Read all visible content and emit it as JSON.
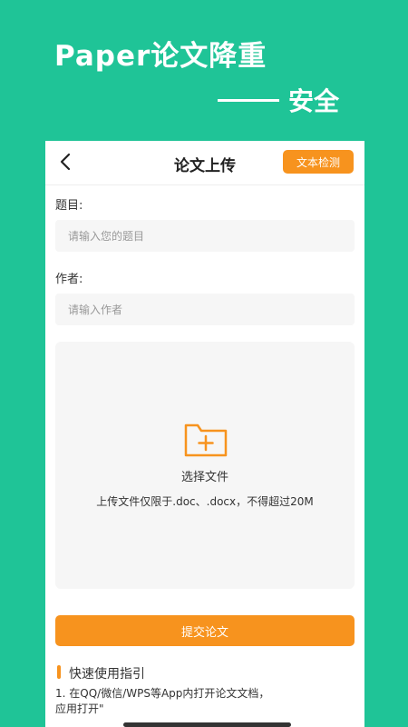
{
  "promo": {
    "title": "Paper论文降重",
    "subtitle": "安全"
  },
  "nav": {
    "back_icon": "chevron-left-icon",
    "title": "论文上传",
    "detect_button": "文本检测"
  },
  "form": {
    "title_label": "题目:",
    "title_placeholder": "请输入您的题目",
    "title_value": "",
    "author_label": "作者:",
    "author_placeholder": "请输入作者",
    "author_value": ""
  },
  "upload": {
    "icon": "folder-plus-icon",
    "label": "选择文件",
    "hint": "上传文件仅限于.doc、.docx，不得超过20M"
  },
  "submit_button": "提交论文",
  "guide": {
    "title": "快速使用指引",
    "text": "1. 在QQ/微信/WPS等App内打开论文文档，应用打开\""
  },
  "colors": {
    "background": "#1fc497",
    "accent": "#f7931e",
    "input_bg": "#f6f6f6"
  }
}
